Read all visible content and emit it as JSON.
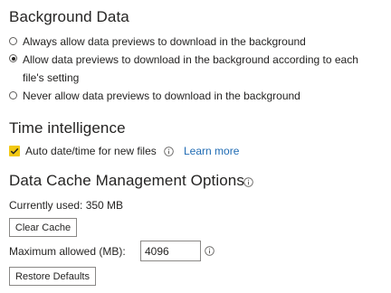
{
  "background_data": {
    "heading": "Background Data",
    "options": [
      {
        "label": "Always allow data previews to download in the background",
        "selected": false
      },
      {
        "label_line1": "Allow data previews to download in the background according to each",
        "label_line2": "file's setting",
        "selected": true
      },
      {
        "label": "Never allow data previews to download in the background",
        "selected": false
      }
    ]
  },
  "time_intelligence": {
    "heading": "Time intelligence",
    "auto_datetime_label": "Auto date/time for new files",
    "auto_datetime_checked": true,
    "learn_more": "Learn more"
  },
  "data_cache": {
    "heading": "Data Cache Management Options",
    "currently_used": "Currently used: 350 MB",
    "clear_cache_label": "Clear Cache",
    "max_allowed_label": "Maximum allowed (MB):",
    "max_allowed_value": "4096",
    "restore_defaults_label": "Restore Defaults"
  },
  "colors": {
    "checkbox_fill": "#f2c811",
    "link": "#1f6bb3",
    "text": "#252423"
  },
  "icons": [
    "radio-icon",
    "checkmark-icon",
    "info-icon"
  ]
}
